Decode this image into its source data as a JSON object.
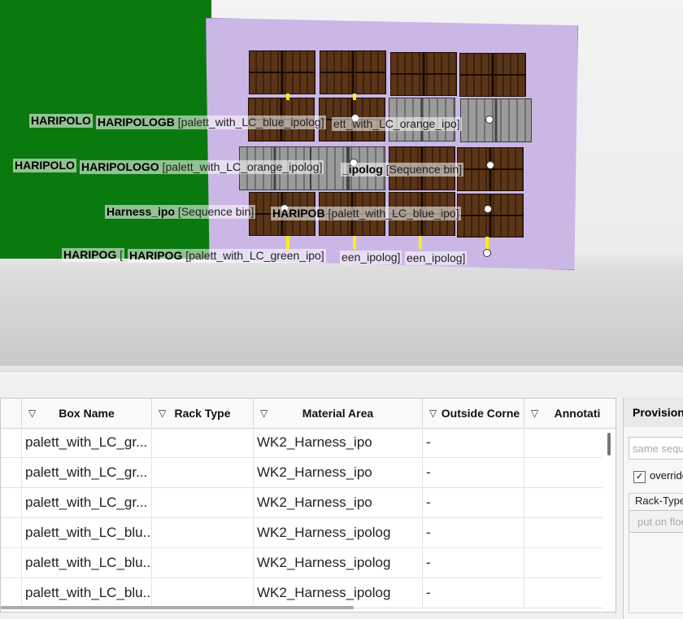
{
  "viewport": {
    "labels": [
      {
        "bold": "HARIPOLO",
        "rest": ""
      },
      {
        "bold": "HARIPOLOGB",
        "rest": " [palett_with_LC_blue_ipolog]"
      },
      {
        "bold": "",
        "rest": "ett_with_LC_orange_ipo]"
      },
      {
        "bold": "HARIPOLO",
        "rest": ""
      },
      {
        "bold": "HARIPOLOGO",
        "rest": " [palett_with_LC_orange_ipolog]"
      },
      {
        "bold": "_ipolog",
        "rest": " [Sequence bin]"
      },
      {
        "bold": "Harness_ipo",
        "rest": " [Sequence bin]"
      },
      {
        "bold": "HARIPOB",
        "rest": " [palett_with_LC_blue_ipo]"
      },
      {
        "bold": "HARIPOG",
        "rest": " ["
      },
      {
        "bold": "HARIPOG",
        "rest": " [palett_with_LC_green_ipo]"
      },
      {
        "bold": "",
        "rest": "een_ipolog]"
      },
      {
        "bold": "",
        "rest": "een_ipolog]"
      }
    ]
  },
  "table": {
    "columns": [
      {
        "label": "",
        "filter": ""
      },
      {
        "label": "Box Name",
        "filter": "▽"
      },
      {
        "label": "Rack Type",
        "filter": "▽"
      },
      {
        "label": "Material Area",
        "filter": "▽"
      },
      {
        "label": "Outside Corne",
        "filter": "▽"
      },
      {
        "label": "Annotati",
        "filter": "▽"
      }
    ],
    "rows": [
      {
        "box_name": "palett_with_LC_gr...",
        "rack_type": "",
        "material_area": "WK2_Harness_ipo",
        "outside_corner": "-",
        "annotation": ""
      },
      {
        "box_name": "palett_with_LC_gr...",
        "rack_type": "",
        "material_area": "WK2_Harness_ipo",
        "outside_corner": "-",
        "annotation": ""
      },
      {
        "box_name": "palett_with_LC_gr...",
        "rack_type": "",
        "material_area": "WK2_Harness_ipo",
        "outside_corner": "-",
        "annotation": ""
      },
      {
        "box_name": "palett_with_LC_blu...",
        "rack_type": "",
        "material_area": "WK2_Harness_ipolog",
        "outside_corner": "-",
        "annotation": ""
      },
      {
        "box_name": "palett_with_LC_blu...",
        "rack_type": "",
        "material_area": "WK2_Harness_ipolog",
        "outside_corner": "-",
        "annotation": ""
      },
      {
        "box_name": "palett_with_LC_blu...",
        "rack_type": "",
        "material_area": "WK2_Harness_ipolog",
        "outside_corner": "-",
        "annotation": ""
      }
    ]
  },
  "side_panel": {
    "title": "Provision",
    "sequence_placeholder": "same seque",
    "override_checked": true,
    "check_mark": "✓",
    "override_label": "override",
    "rack_type_label": "Rack-Type",
    "rack_type_value": "put on floo"
  },
  "colors": {
    "wall": "#0a7a0f",
    "plane": "#cbb7e6",
    "pallet_brown": "#4b2b12",
    "pallet_gray": "#8a8a8a",
    "post_yellow": "#ffee00"
  }
}
